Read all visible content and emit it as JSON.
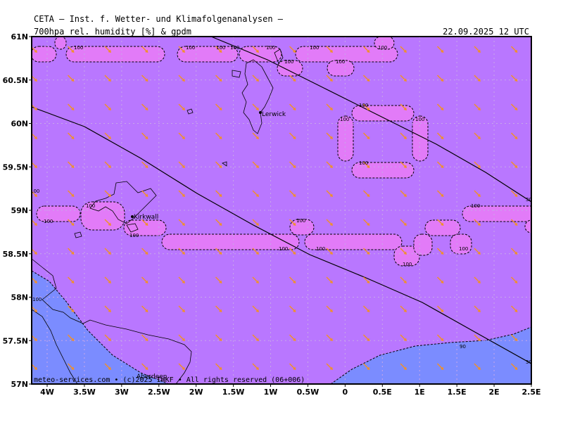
{
  "header": {
    "title": "CETA — Inst. f. Wetter- und Klimafolgenanalysen —",
    "subtitle": "700hpa_rel._humidity_[%]_&_gpdm",
    "datetime": "22.09.2025 12 UTC"
  },
  "map": {
    "lat_labels": [
      "61N",
      "60.5N",
      "60N",
      "59.5N",
      "59N",
      "58.5N",
      "58N",
      "57.5N",
      "57N"
    ],
    "lon_labels": [
      "4W",
      "3.5W",
      "3W",
      "2.5W",
      "2W",
      "1.5W",
      "1W",
      "0.5W",
      "0",
      "0.5E",
      "1E",
      "1.5E",
      "2E",
      "2.5E"
    ],
    "contour_label": "100",
    "low_label": "90",
    "gpdm_label": "30",
    "places": [
      "Lerwick",
      "Kirkwall",
      "Aberdeen"
    ],
    "colors": {
      "humid_main": "#b977ff",
      "humid_high": "#e27bf8",
      "humid_low": "#7b8cff",
      "wind_arrow": "#f0902a",
      "grid": "#c8a8e8"
    }
  },
  "footer": {
    "text": "meteo-services.com • (c)2025 IWKF • All rights reserved (06+006)"
  }
}
